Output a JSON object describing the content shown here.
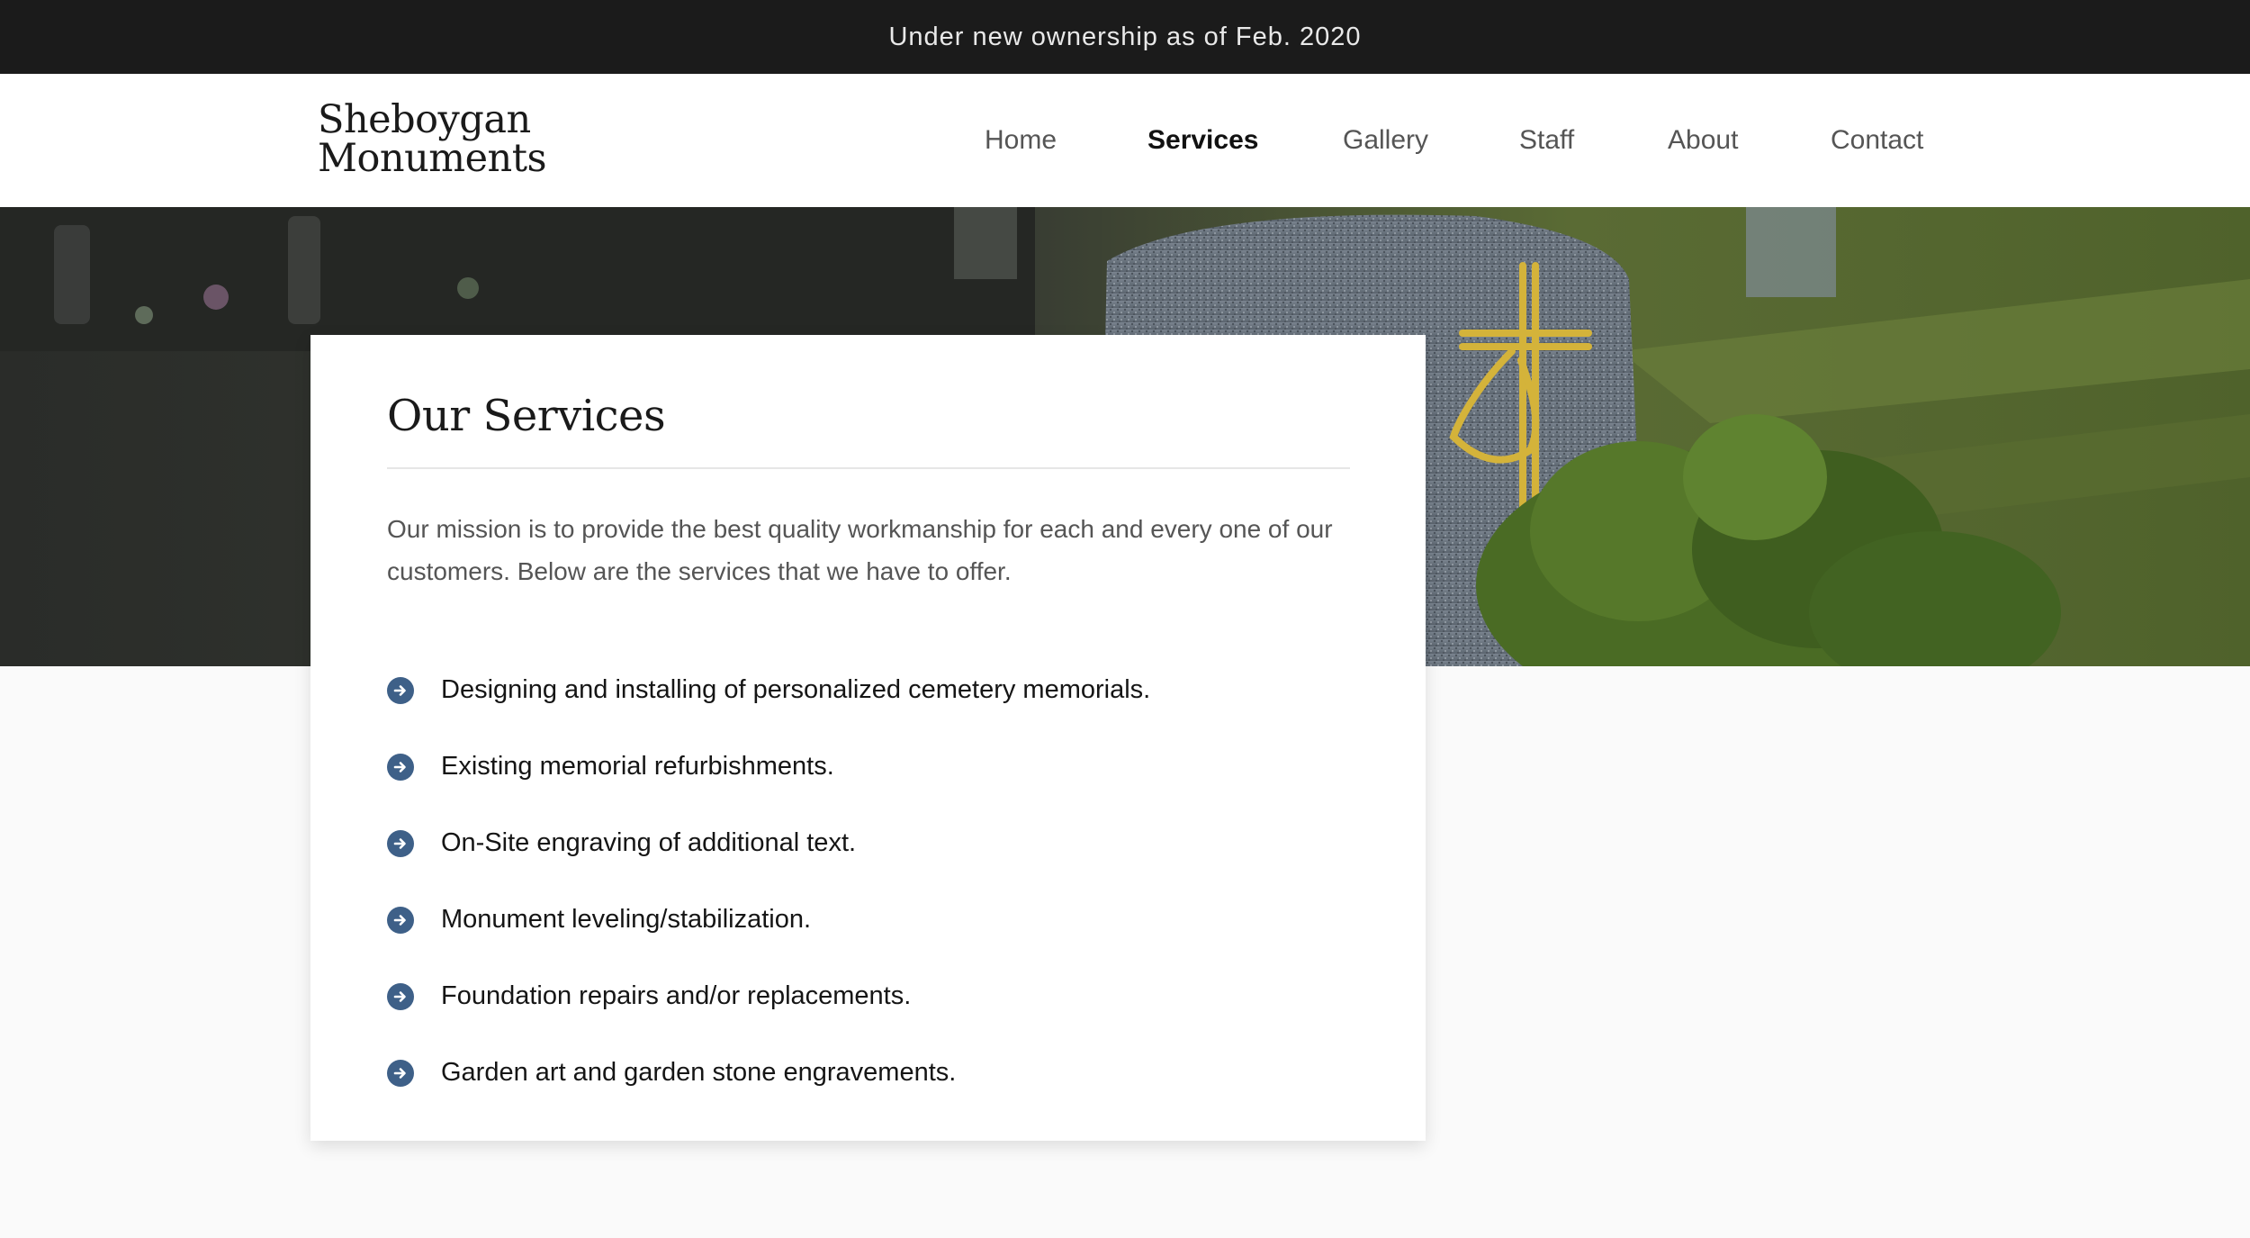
{
  "announcement": "Under new ownership as of Feb. 2020",
  "logo": {
    "line1": "Sheboygan",
    "line2": "Monuments"
  },
  "nav": [
    {
      "label": "Home",
      "active": false
    },
    {
      "label": "Services",
      "active": true
    },
    {
      "label": "Gallery",
      "active": false
    },
    {
      "label": "Staff",
      "active": false
    },
    {
      "label": "About",
      "active": false
    },
    {
      "label": "Contact",
      "active": false
    }
  ],
  "hero": {
    "image": "cemetery-headstone-photo"
  },
  "services": {
    "title": "Our Services",
    "intro": "Our mission is to provide the best quality workmanship for each and every one of our customers. Below are the services that we have to offer.",
    "items": [
      "Designing and installing of personalized cemetery memorials.",
      "Existing memorial refurbishments.",
      "On-Site engraving of additional text.",
      "Monument leveling/stabilization.",
      "Foundation repairs and/or replacements.",
      "Garden art and garden stone engravements."
    ],
    "bullet_icon": "arrow-circle-right-icon",
    "bullet_color": "#3e6088"
  },
  "colors": {
    "topbar": "#1b1b1b",
    "accent": "#3e6088",
    "background": "#fafafa"
  }
}
